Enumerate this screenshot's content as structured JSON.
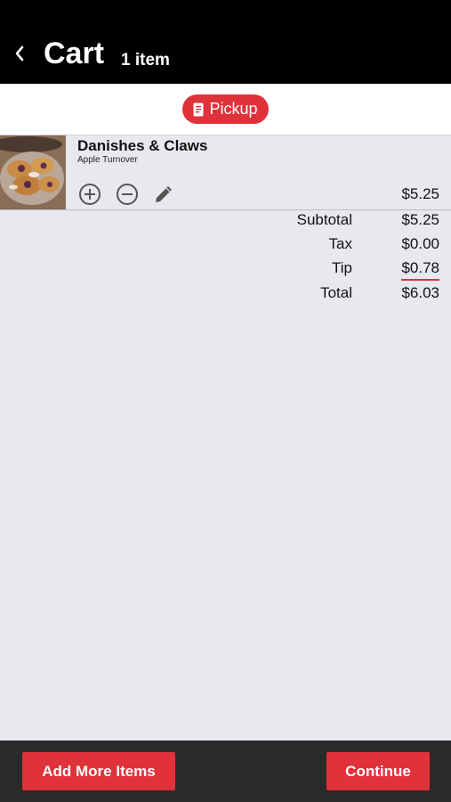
{
  "header": {
    "title": "Cart",
    "count": "1 item",
    "back_icon": "chevron-left-icon"
  },
  "mode": {
    "label": "Pickup",
    "icon": "receipt-icon",
    "color": "#e0323b"
  },
  "items": [
    {
      "name": "Danishes & Claws",
      "subtitle": "Apple Turnover",
      "price": "$5.25",
      "icons": [
        "plus-circle-icon",
        "minus-circle-icon",
        "pencil-icon"
      ]
    }
  ],
  "summary": {
    "subtotal": {
      "label": "Subtotal",
      "value": "$5.25"
    },
    "tax": {
      "label": "Tax",
      "value": "$0.00"
    },
    "tip": {
      "label": "Tip",
      "value": "$0.78"
    },
    "total": {
      "label": "Total",
      "value": "$6.03"
    }
  },
  "footer": {
    "add_more_label": "Add More Items",
    "continue_label": "Continue"
  },
  "colors": {
    "accent": "#e0323b",
    "header_bg": "#000000",
    "footer_bg": "#2a2a2a",
    "page_bg": "#e9e8ee"
  }
}
